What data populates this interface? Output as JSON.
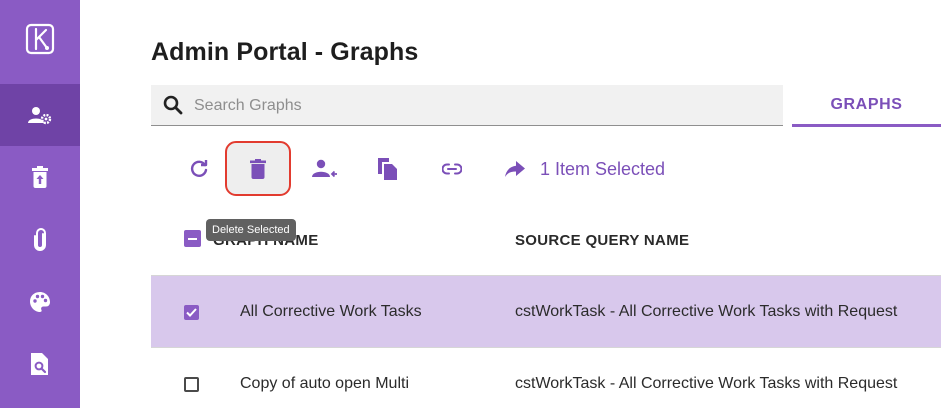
{
  "sidebar": {
    "items": [
      {
        "icon": "app-logo-icon"
      },
      {
        "icon": "user-admin-icon",
        "active": true
      },
      {
        "icon": "trash-restore-icon"
      },
      {
        "icon": "paperclip-icon"
      },
      {
        "icon": "palette-icon"
      },
      {
        "icon": "document-search-icon"
      }
    ]
  },
  "header": {
    "title": "Admin Portal - Graphs",
    "search_placeholder": "Search Graphs",
    "tab_label": "GRAPHS"
  },
  "toolbar": {
    "buttons": [
      "refresh-icon",
      "delete-icon",
      "assign-user-icon",
      "copy-icon",
      "link-icon",
      "share-icon"
    ],
    "selected_text": "1 Item Selected",
    "tooltip": "Delete Selected"
  },
  "table": {
    "columns": [
      "GRAPH NAME",
      "SOURCE QUERY NAME"
    ],
    "rows": [
      {
        "name": "All Corrective Work Tasks",
        "query": "cstWorkTask - All Corrective Work Tasks with Request",
        "selected": true
      },
      {
        "name": "Copy of auto open Multi",
        "query": "cstWorkTask - All Corrective Work Tasks with Request",
        "selected": false
      }
    ]
  },
  "colors": {
    "sidebar": "#8a5bc4",
    "sidebar_active": "#6f43a6",
    "accent": "#7b4fb8",
    "selected_row": "#d8c8ec",
    "highlight_border": "#e23b2f"
  }
}
